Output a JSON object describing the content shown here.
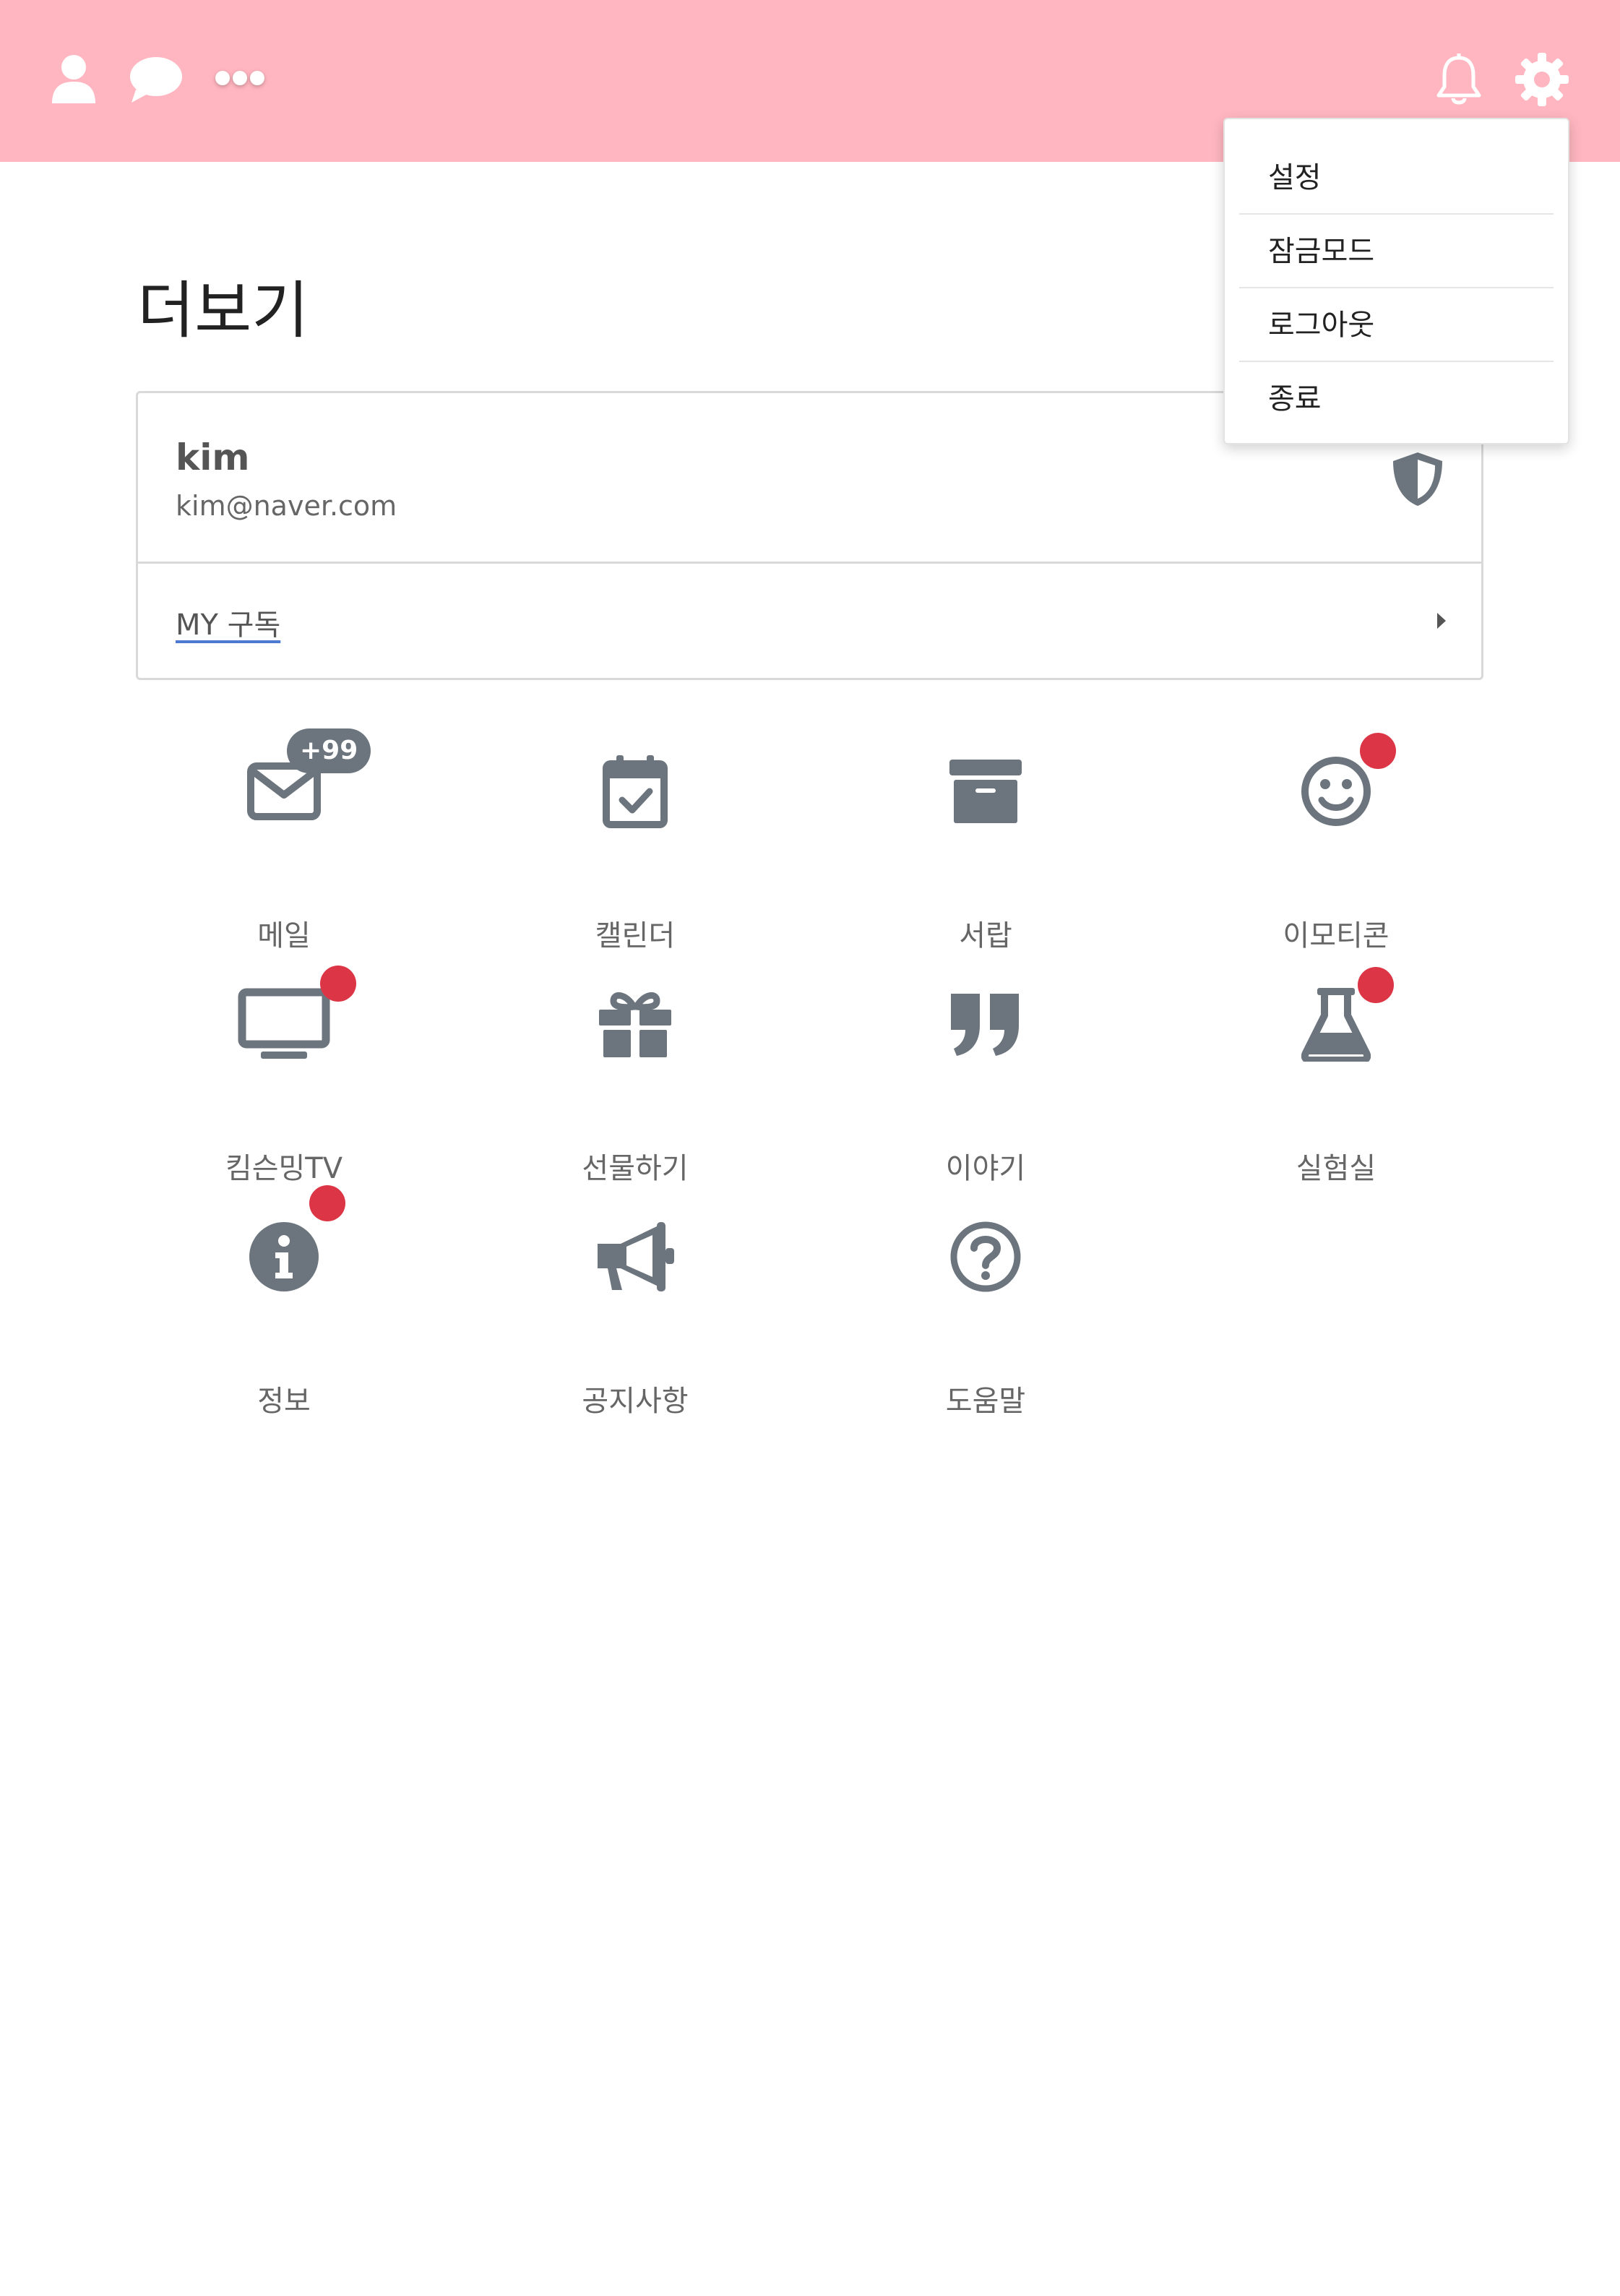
{
  "colors": {
    "topbar": "#FFB6C0",
    "icon_gray": "#6c757d",
    "notification_red": "#DC3545"
  },
  "topbar": {
    "left_icons": [
      "user-icon",
      "chat-icon",
      "more-icon"
    ],
    "right_icons": [
      "bell-icon",
      "gear-icon"
    ]
  },
  "dropdown": {
    "items": [
      "설정",
      "잠금모드",
      "로그아웃",
      "종료"
    ]
  },
  "page": {
    "title": "더보기"
  },
  "profile": {
    "name": "kim",
    "email": "kim@naver.com",
    "subscribe_label": "MY 구독"
  },
  "menu": [
    {
      "label": "메일",
      "icon": "envelope-icon",
      "badge": "+99"
    },
    {
      "label": "캘린더",
      "icon": "calendar-check-icon"
    },
    {
      "label": "서랍",
      "icon": "archive-icon"
    },
    {
      "label": "이모티콘",
      "icon": "smile-icon",
      "dot": true
    },
    {
      "label": "킴슨밍TV",
      "icon": "tv-icon",
      "dot": true
    },
    {
      "label": "선물하기",
      "icon": "gift-icon"
    },
    {
      "label": "이야기",
      "icon": "quote-icon"
    },
    {
      "label": "실험실",
      "icon": "flask-icon",
      "dot": true
    },
    {
      "label": "정보",
      "icon": "info-icon",
      "dot": true
    },
    {
      "label": "공지사항",
      "icon": "megaphone-icon"
    },
    {
      "label": "도움말",
      "icon": "question-icon"
    }
  ]
}
